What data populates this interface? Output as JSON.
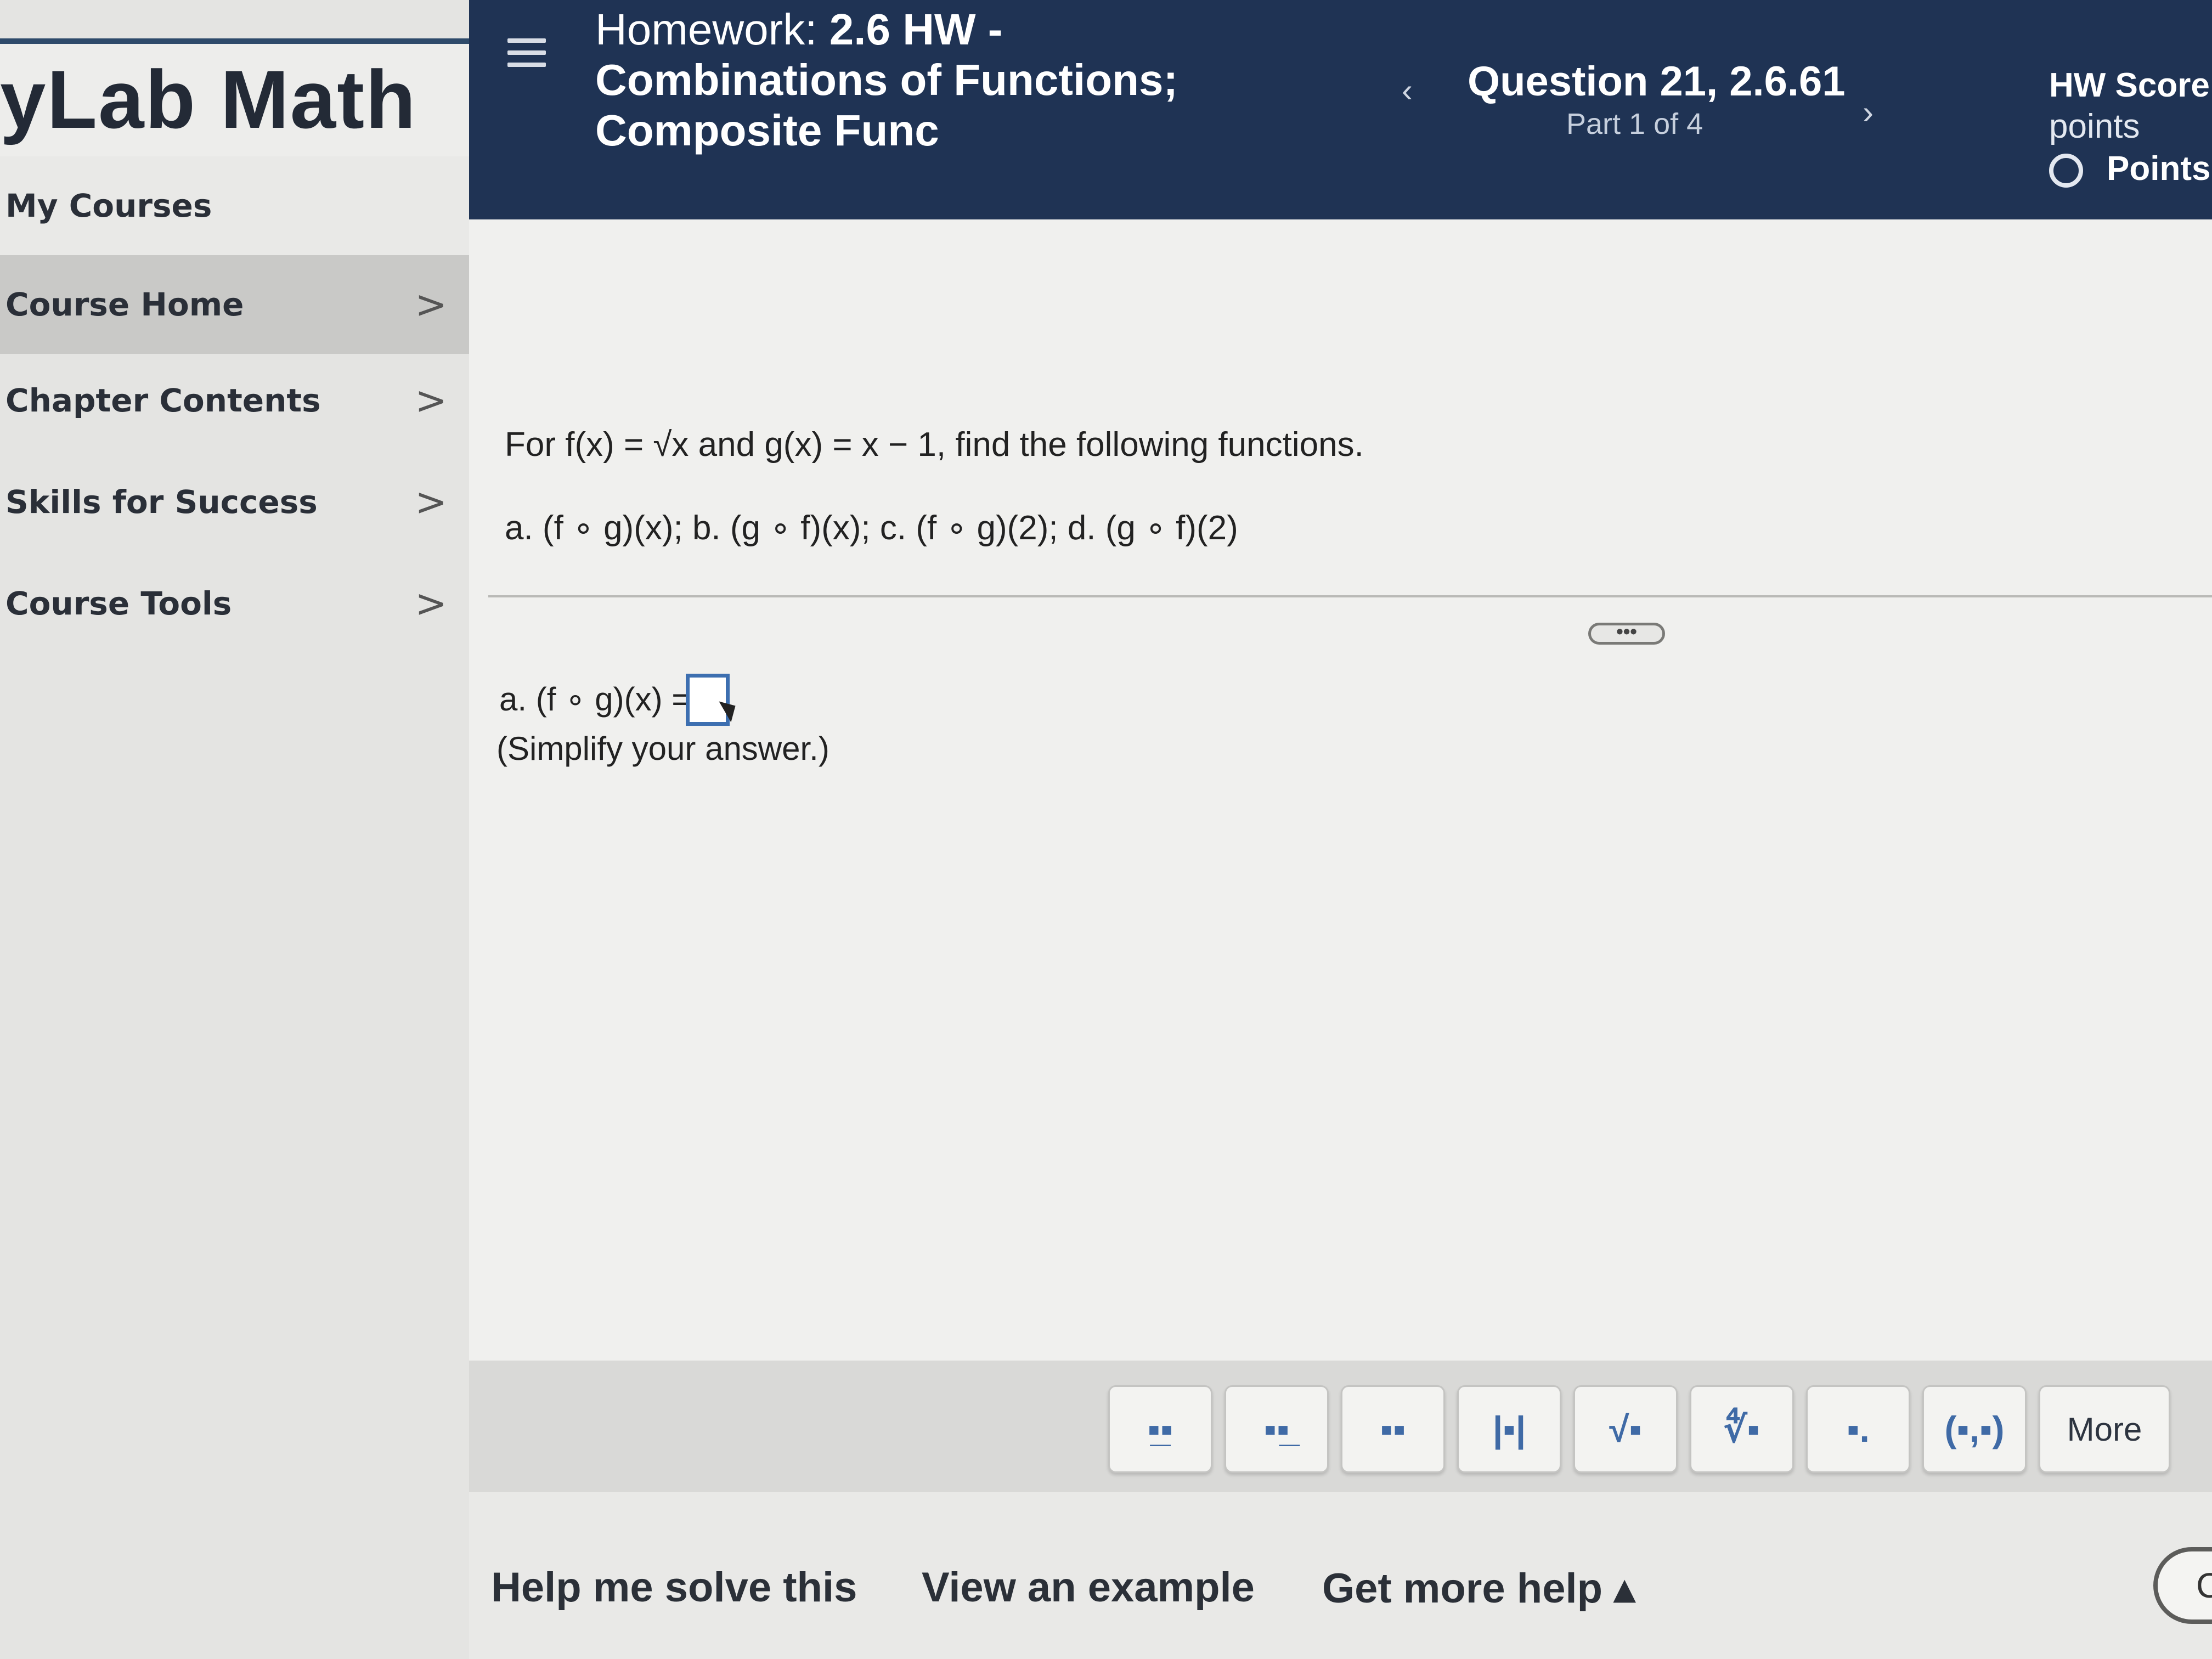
{
  "sidebar": {
    "brand": "yLab Math",
    "items": [
      {
        "label": "My Courses",
        "has_chevron": false
      },
      {
        "label": "Course Home",
        "has_chevron": true
      },
      {
        "label": "Chapter Contents",
        "has_chevron": true
      },
      {
        "label": "Skills for Success",
        "has_chevron": true
      },
      {
        "label": "Course Tools",
        "has_chevron": true
      }
    ],
    "chevron_icon": "chevron-right-icon",
    "chevron_glyph": ">"
  },
  "header": {
    "menu_icon": "hamburger-menu-icon",
    "hw_prefix": "Homework:",
    "hw_title_line1": "2.6 HW -",
    "hw_title_line2": "Combinations of Functions;",
    "hw_title_line3": "Composite Func",
    "prev_glyph": "‹",
    "next_glyph": "›",
    "question_title": "Question 21, 2.6.61",
    "question_part": "Part 1 of 4",
    "hw_score_label": "HW Score:",
    "points_label": "points",
    "points_status_label": "Points:",
    "colors": {
      "background": "#1f3354",
      "text": "#ffffff"
    }
  },
  "question": {
    "statement": "For f(x) = √x and g(x) = x − 1, find the following functions.",
    "parts": "a. (f ∘ g)(x); b. (g ∘ f)(x); c. (f ∘ g)(2); d. (g ∘ f)(2)",
    "expand_glyph": "•••",
    "answer_label": "a. (f ∘ g)(x) =",
    "answer_value": "",
    "hint": "(Simplify your answer.)"
  },
  "math_toolbar": {
    "buttons": [
      {
        "name": "fraction-icon",
        "glyph": "▪̲▪"
      },
      {
        "name": "mixed-number-icon",
        "glyph": "▪▪̲"
      },
      {
        "name": "exponent-icon",
        "glyph": "▪▪"
      },
      {
        "name": "absolute-value-icon",
        "glyph": "|▪|"
      },
      {
        "name": "square-root-icon",
        "glyph": "√▪"
      },
      {
        "name": "nth-root-icon",
        "glyph": "∜▪"
      },
      {
        "name": "decimal-icon",
        "glyph": "▪."
      },
      {
        "name": "ordered-pair-icon",
        "glyph": "(▪,▪)"
      }
    ],
    "more_label": "More",
    "accent_color": "#3f6aa6"
  },
  "help": {
    "help_me_solve": "Help me solve this",
    "view_example": "View an example",
    "get_more_help": "Get more help ▴",
    "check_label": "C"
  }
}
